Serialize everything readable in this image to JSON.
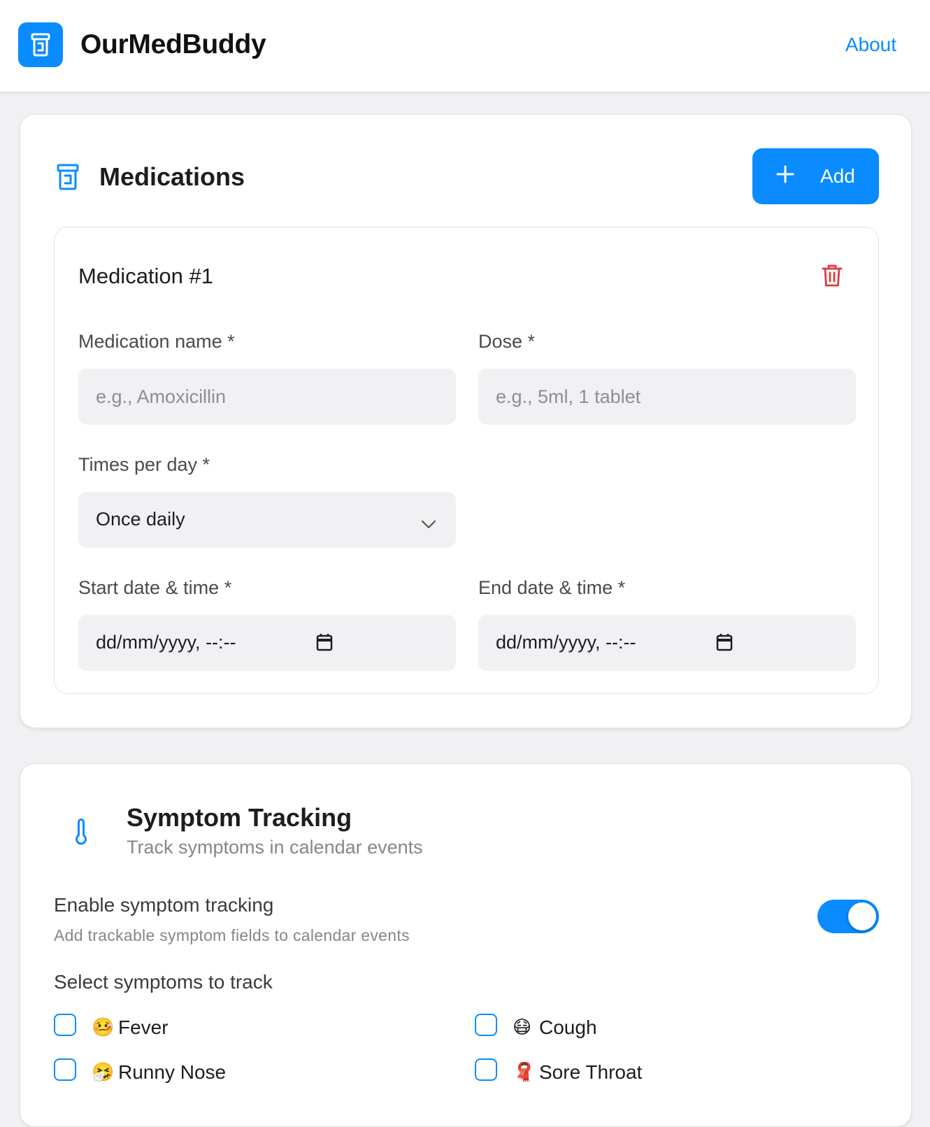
{
  "header": {
    "app_name": "OurMedBuddy",
    "about_link": "About",
    "logo_icon": "pill-bottle-icon"
  },
  "colors": {
    "accent": "#0a8bff",
    "danger": "#e5383b",
    "background": "#f1f1f3",
    "field_bg": "#f1f1f3"
  },
  "medications": {
    "title": "Medications",
    "add_button": "Add",
    "items": [
      {
        "title": "Medication #1",
        "name_label": "Medication name *",
        "name_placeholder": "e.g., Amoxicillin",
        "dose_label": "Dose *",
        "dose_placeholder": "e.g., 5ml, 1 tablet",
        "times_label": "Times per day *",
        "times_value": "Once daily",
        "start_label": "Start date & time *",
        "start_value": "dd/mm/yyyy, --:--",
        "end_label": "End date & time *",
        "end_value": "dd/mm/yyyy, --:--"
      }
    ]
  },
  "symptoms": {
    "title": "Symptom Tracking",
    "subtitle": "Track symptoms in calendar events",
    "toggle_label": "Enable symptom tracking",
    "toggle_sub": "Add trackable symptom fields to calendar events",
    "toggle_on": true,
    "select_label": "Select symptoms to track",
    "items": [
      {
        "emoji": "🤒",
        "label": "Fever"
      },
      {
        "emoji": "😷",
        "label": "Cough"
      },
      {
        "emoji": "🤧",
        "label": "Runny Nose"
      },
      {
        "emoji": "🧣",
        "label": "Sore Throat"
      }
    ]
  }
}
